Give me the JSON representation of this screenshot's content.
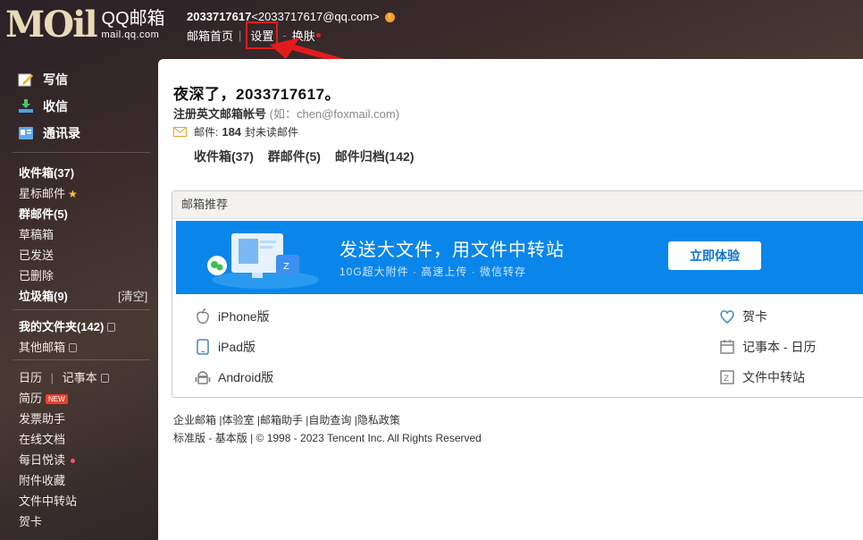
{
  "header": {
    "logo_mark": "MOil",
    "logo_title": "QQ邮箱",
    "logo_domain": "mail.qq.com",
    "username": "2033717617",
    "email": "<2033717617@qq.com>",
    "warn_symbol": "!",
    "nav": {
      "home": "邮箱首页",
      "sep": "|",
      "settings": "设置",
      "dash": "-",
      "skin": "换肤"
    }
  },
  "sidebar": {
    "compose": "写信",
    "receive": "收信",
    "contacts": "通讯录",
    "inbox": "收件箱(37)",
    "starred": "星标邮件",
    "group": "群邮件(5)",
    "drafts": "草稿箱",
    "sent": "已发送",
    "deleted": "已删除",
    "spam": "垃圾箱(9)",
    "clear": "[清空]",
    "my_folders": "我的文件夹(142)",
    "other_mailboxes": "其他邮箱",
    "calendar": "日历",
    "cal_sep": "|",
    "notebook": "记事本",
    "resume": "简历",
    "new_badge": "NEW",
    "invoice": "发票助手",
    "docs": "在线文档",
    "daily": "每日悦读",
    "favorites": "附件收藏",
    "transfer": "文件中转站",
    "greeting_card": "贺卡"
  },
  "main": {
    "greeting": "夜深了，2033717617。",
    "register": "注册英文邮箱帐号",
    "register_hint": "(如：chen@foxmail.com)",
    "mail_label": "邮件:",
    "mail_count": "184",
    "mail_unit": "封未读邮件",
    "inbox_count": "收件箱(37)",
    "group_count": "群邮件(5)",
    "archive_count": "邮件归档(142)",
    "rec_title": "邮箱推荐",
    "banner_title": "发送大文件，用文件中转站",
    "banner_sub": "10G超大附件 · 高速上传 · 微信转存",
    "banner_btn": "立即体验",
    "links": {
      "iphone": "iPhone版",
      "ipad": "iPad版",
      "android": "Android版",
      "card": "贺卡",
      "notebook_calendar": "记事本 - 日历",
      "transfer": "文件中转站"
    },
    "footer": {
      "enterprise": "企业邮箱",
      "lab": "|体验室",
      "assistant": "|邮箱助手",
      "self_query": "|自助查询",
      "privacy": "|隐私政策",
      "standard": "标准版",
      "dash": "-",
      "basic": "基本版",
      "copyright": "| © 1998 - 2023 Tencent Inc. All Rights Reserved"
    }
  },
  "colors": {
    "highlight_red": "#e21c1c",
    "banner_blue": "#0a86ea",
    "warn_orange": "#f0a12a"
  }
}
